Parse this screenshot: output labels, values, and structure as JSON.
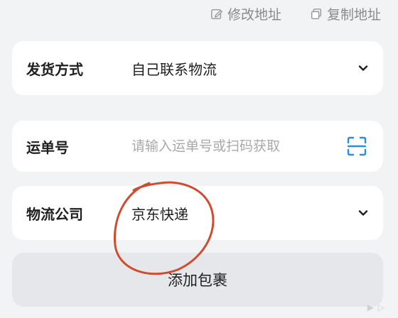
{
  "top_actions": {
    "edit_address": "修改地址",
    "copy_address": "复制地址"
  },
  "shipping_method": {
    "label": "发货方式",
    "value": "自己联系物流"
  },
  "waybill": {
    "label": "运单号",
    "placeholder": "请输入运单号或扫码获取",
    "value": ""
  },
  "courier_company": {
    "label": "物流公司",
    "value": "京东快递"
  },
  "add_package_button": "添加包裹",
  "colors": {
    "accent": "#2a8ee6",
    "annotation": "#d14b2e",
    "card_bg": "#ffffff",
    "page_bg": "#f2f3f5",
    "button_bg": "#e6e7ea"
  },
  "icons": {
    "edit": "edit-icon",
    "copy": "copy-icon",
    "chevron": "chevron-down-icon",
    "scan": "scan-icon"
  }
}
